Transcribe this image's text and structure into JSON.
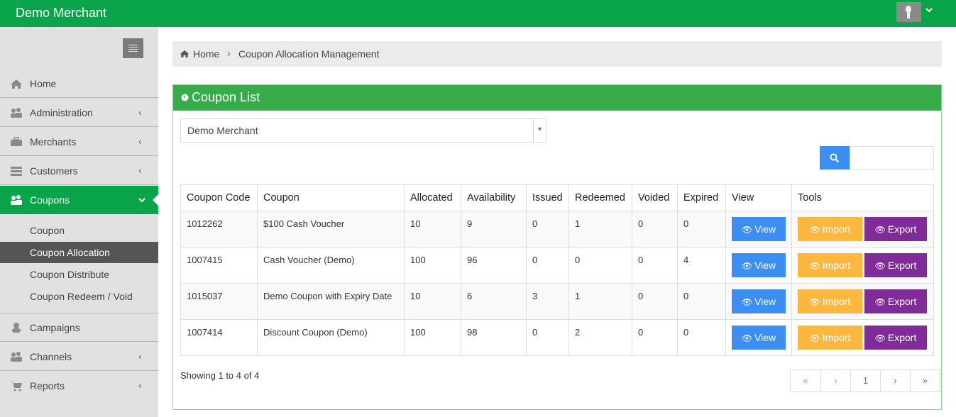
{
  "app": {
    "brand": "Demo Merchant"
  },
  "sidebar": {
    "items": [
      {
        "label": "Home",
        "icon": "home-icon",
        "has_chevron": false
      },
      {
        "label": "Administration",
        "icon": "users-icon",
        "has_chevron": true
      },
      {
        "label": "Merchants",
        "icon": "briefcase-icon",
        "has_chevron": true
      },
      {
        "label": "Customers",
        "icon": "list-icon",
        "has_chevron": true
      },
      {
        "label": "Coupons",
        "icon": "users-icon",
        "has_chevron": true,
        "active": true
      },
      {
        "label": "Campaigns",
        "icon": "user-icon",
        "has_chevron": false
      },
      {
        "label": "Channels",
        "icon": "users-icon",
        "has_chevron": true
      },
      {
        "label": "Reports",
        "icon": "cart-icon",
        "has_chevron": true
      }
    ],
    "sub_items": [
      {
        "label": "Coupon"
      },
      {
        "label": "Coupon Allocation",
        "active": true
      },
      {
        "label": "Coupon Distribute"
      },
      {
        "label": "Coupon Redeem / Void"
      }
    ]
  },
  "breadcrumb": {
    "home": "Home",
    "separator": "›",
    "current": "Coupon Allocation Management"
  },
  "panel": {
    "title": "Coupon List"
  },
  "filter": {
    "merchant_value": "Demo Merchant",
    "arrow": "▼"
  },
  "search": {
    "placeholder": ""
  },
  "table": {
    "headers": [
      "Coupon Code",
      "Coupon",
      "Allocated",
      "Availability",
      "Issued",
      "Redeemed",
      "Voided",
      "Expired",
      "View",
      "Tools"
    ],
    "rows": [
      {
        "code": "1012262",
        "coupon": "$100 Cash Voucher",
        "allocated": "10",
        "availability": "9",
        "issued": "0",
        "redeemed": "1",
        "voided": "0",
        "expired": "0"
      },
      {
        "code": "1007415",
        "coupon": "Cash Voucher (Demo)",
        "allocated": "100",
        "availability": "96",
        "issued": "0",
        "redeemed": "0",
        "voided": "0",
        "expired": "4"
      },
      {
        "code": "1015037",
        "coupon": "Demo Coupon with Expiry Date",
        "allocated": "10",
        "availability": "6",
        "issued": "3",
        "redeemed": "1",
        "voided": "0",
        "expired": "0"
      },
      {
        "code": "1007414",
        "coupon": "Discount Coupon (Demo)",
        "allocated": "100",
        "availability": "98",
        "issued": "0",
        "redeemed": "2",
        "voided": "0",
        "expired": "0"
      }
    ],
    "view_label": "View",
    "import_label": "Import",
    "export_label": "Export"
  },
  "footer": {
    "showing": "Showing 1 to 4 of 4"
  },
  "pager": {
    "first": "«",
    "prev": "‹",
    "page": "1",
    "next": "›",
    "last": "»"
  },
  "colors": {
    "topbar": "#0aa54a",
    "panel_head": "#36ac4a",
    "view": "#3c8ef3",
    "import": "#fcb73f",
    "export": "#7f2c99"
  }
}
